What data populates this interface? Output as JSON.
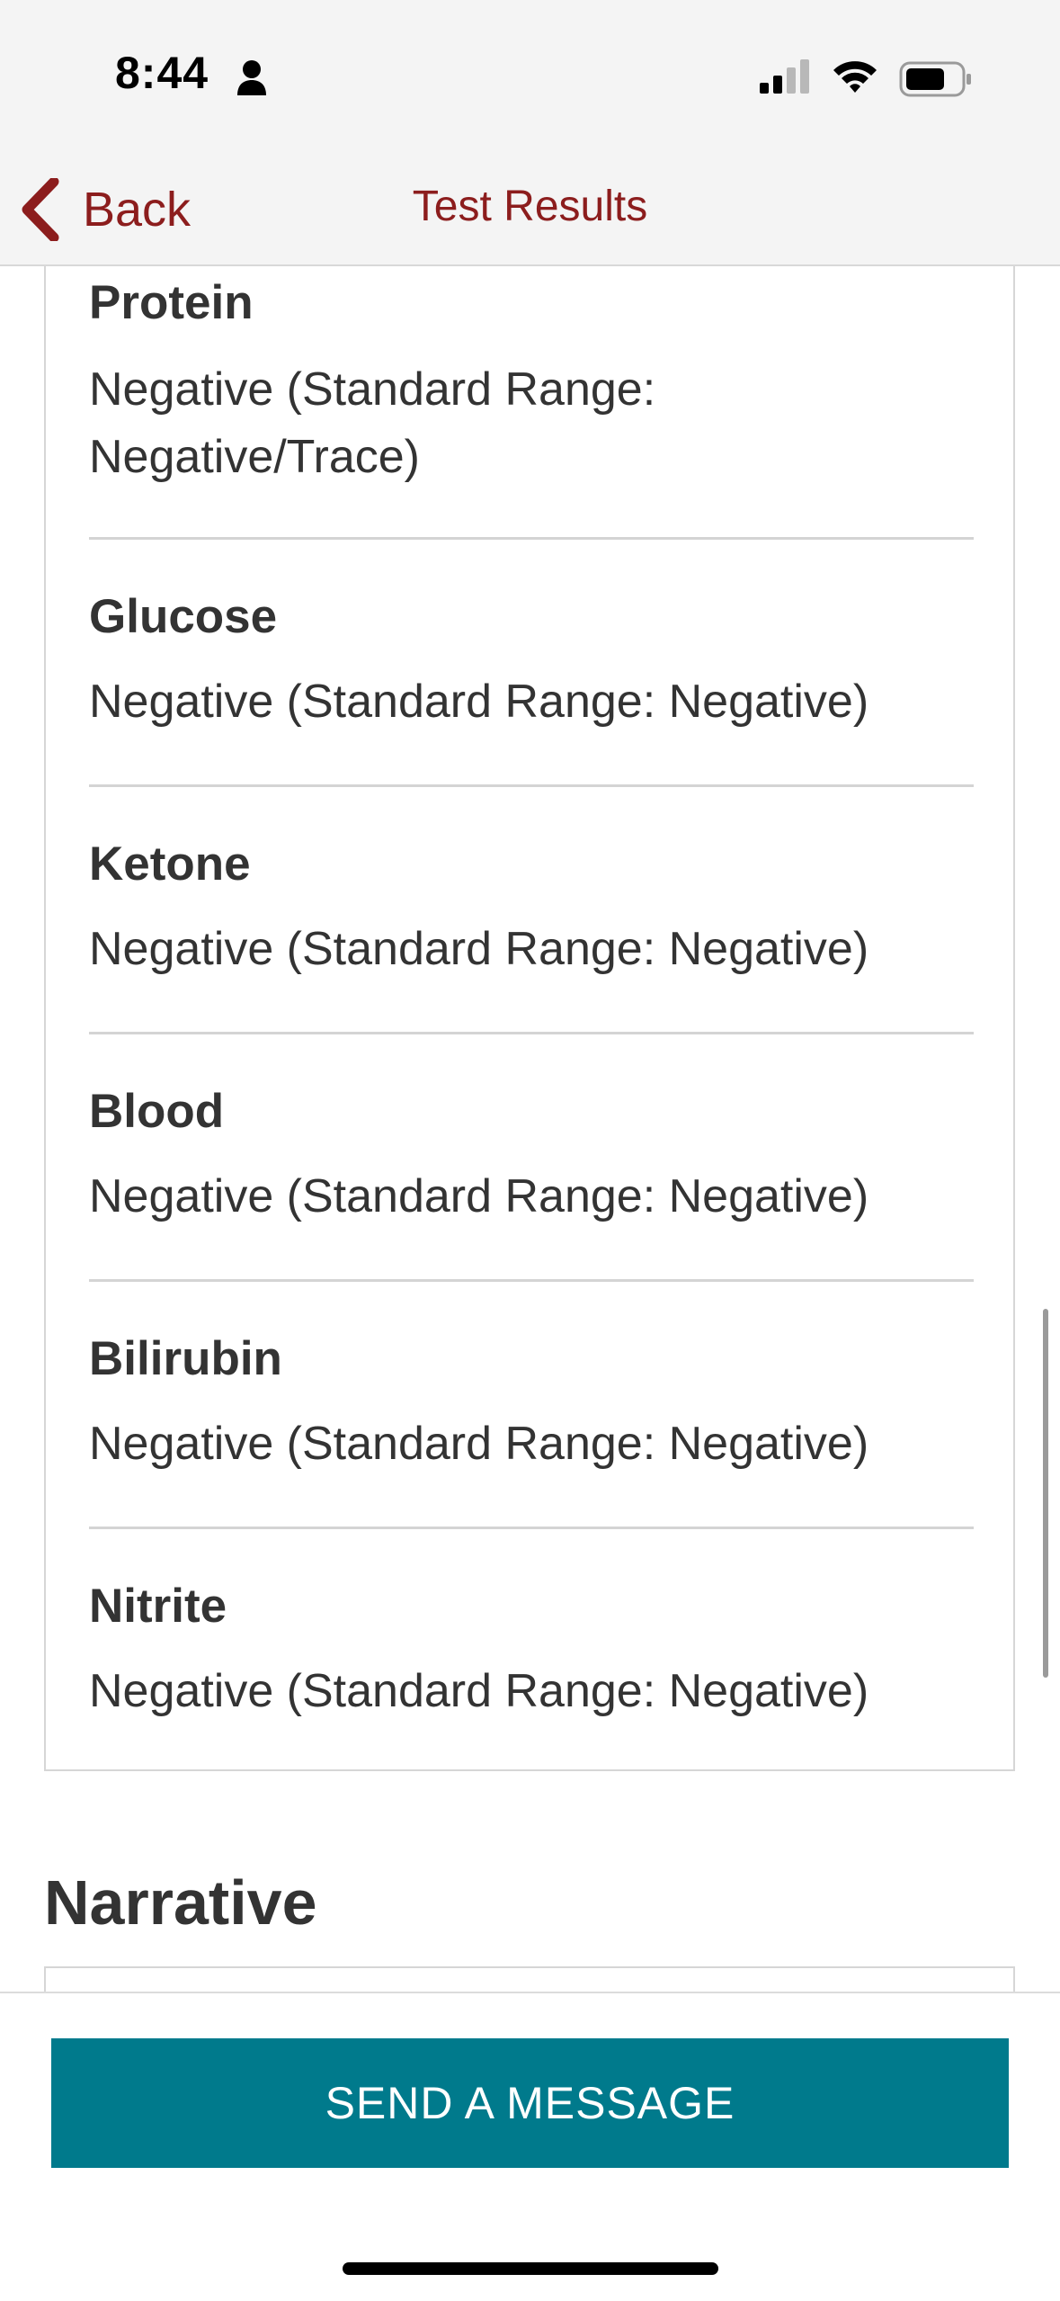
{
  "status_bar": {
    "time": "8:44"
  },
  "nav": {
    "back_label": "Back",
    "title": "Test Results"
  },
  "results": [
    {
      "name": "Protein",
      "value": "Negative (Standard Range: Negative/Trace)"
    },
    {
      "name": "Glucose",
      "value": "Negative (Standard Range: Negative)"
    },
    {
      "name": "Ketone",
      "value": "Negative (Standard Range: Negative)"
    },
    {
      "name": "Blood",
      "value": "Negative (Standard Range: Negative)"
    },
    {
      "name": "Bilirubin",
      "value": "Negative (Standard Range: Negative)"
    },
    {
      "name": "Nitrite",
      "value": "Negative (Standard Range: Negative)"
    }
  ],
  "narrative": {
    "heading": "Narrative"
  },
  "footer": {
    "send_button_label": "SEND A MESSAGE"
  },
  "colors": {
    "accent_red": "#8c1d1d",
    "button_teal": "#007a8c",
    "text_dark": "#333333"
  }
}
